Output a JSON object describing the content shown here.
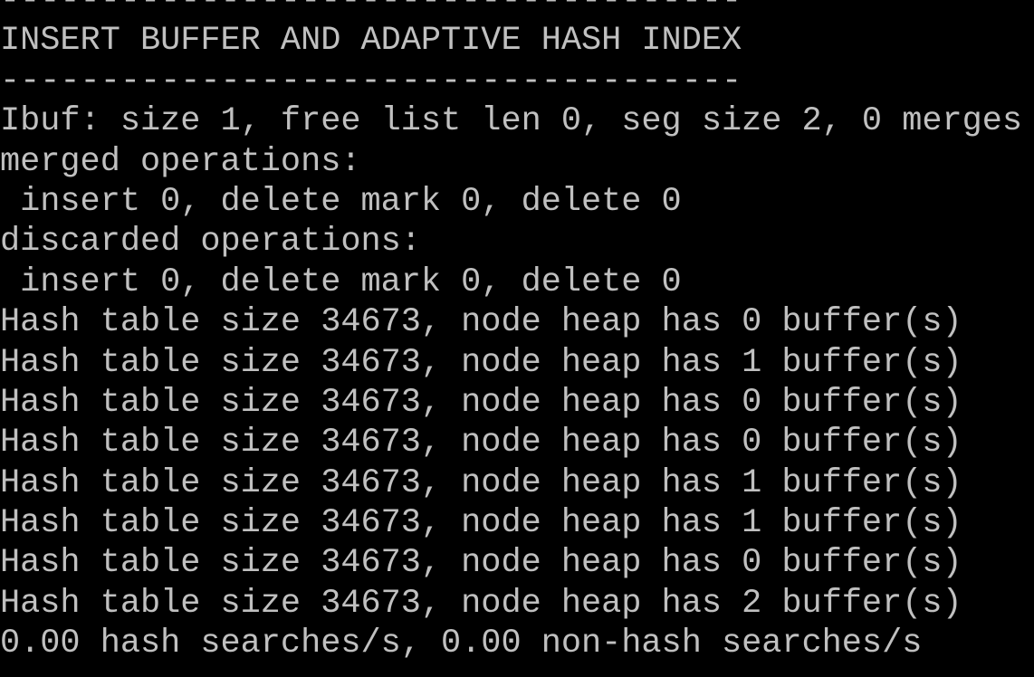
{
  "terminal": {
    "text_color": "#c0c0c0",
    "background_color": "#000000",
    "lines": [
      "-------------------------------------",
      "INSERT BUFFER AND ADAPTIVE HASH INDEX",
      "-------------------------------------",
      "Ibuf: size 1, free list len 0, seg size 2, 0 merges",
      "merged operations:",
      " insert 0, delete mark 0, delete 0",
      "discarded operations:",
      " insert 0, delete mark 0, delete 0",
      "Hash table size 34673, node heap has 0 buffer(s)",
      "Hash table size 34673, node heap has 1 buffer(s)",
      "Hash table size 34673, node heap has 0 buffer(s)",
      "Hash table size 34673, node heap has 0 buffer(s)",
      "Hash table size 34673, node heap has 1 buffer(s)",
      "Hash table size 34673, node heap has 1 buffer(s)",
      "Hash table size 34673, node heap has 0 buffer(s)",
      "Hash table size 34673, node heap has 2 buffer(s)",
      "0.00 hash searches/s, 0.00 non-hash searches/s"
    ]
  }
}
